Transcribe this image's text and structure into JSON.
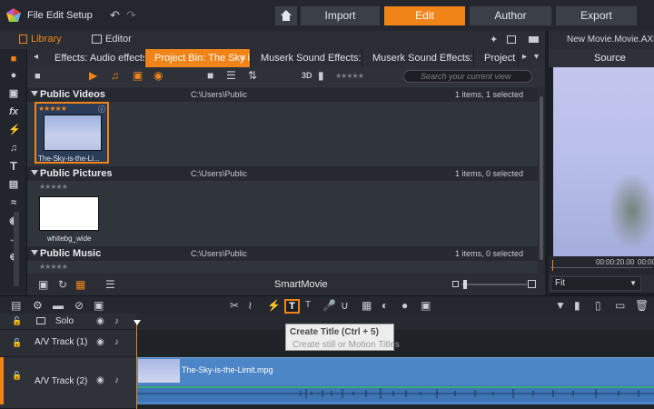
{
  "app": {
    "menu": [
      "File",
      "Edit",
      "Setup"
    ],
    "modes": [
      {
        "label": "Import",
        "active": false
      },
      {
        "label": "Edit",
        "active": true
      },
      {
        "label": "Author",
        "active": false
      },
      {
        "label": "Export",
        "active": false
      }
    ],
    "accent_color": "#f08419"
  },
  "library_header": {
    "library_label": "Library",
    "editor_label": "Editor"
  },
  "tabs": [
    {
      "label": "Effects: Audio effects",
      "active": false
    },
    {
      "label": "Project Bin: The Sky is...",
      "active": true
    },
    {
      "label": "Muserk Sound Effects:...",
      "active": false
    },
    {
      "label": "Muserk Sound Effects:...",
      "active": false
    },
    {
      "label": "Project B",
      "active": false
    }
  ],
  "library_tools": {
    "view_3d": "3D",
    "search_placeholder": "Search your current view"
  },
  "sections": [
    {
      "title": "Public Videos",
      "path": "C:\\Users\\Public",
      "count": "1 items, 1 selected",
      "item_name": "The-Sky-is-the-Li..."
    },
    {
      "title": "Public Pictures",
      "path": "C:\\Users\\Public",
      "count": "1 items, 0 selected",
      "item_name": "whitebg_wide"
    },
    {
      "title": "Public Music",
      "path": "C:\\Users\\Public",
      "count": "1 items, 0 selected"
    }
  ],
  "library_bottom": {
    "smartmovie": "SmartMovie"
  },
  "player": {
    "project_title": "New Movie.Movie.AXP*",
    "source_label": "Source",
    "timecodes": [
      "00:00:20.00",
      "00:00"
    ],
    "fit_label": "Fit"
  },
  "timeline": {
    "tooltip_title": "Create Title (Ctrl + 5)",
    "tooltip_desc": "Create still or Motion Titles",
    "title_tool_glyph": "T",
    "title_glyph_2": "T",
    "tracks": [
      {
        "label": "Solo"
      },
      {
        "label": "A/V Track (1)"
      },
      {
        "label": "A/V Track (2)"
      }
    ],
    "clip_name": "The-Sky-is-the-Limit.mpg"
  },
  "glyphs": {
    "fx": "fx",
    "text_t": "T",
    "stars": "★★★★★"
  }
}
